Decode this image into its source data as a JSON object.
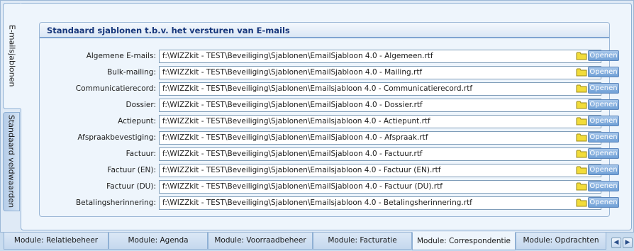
{
  "vertical_tabs": {
    "emails_label": "E-mailsjablonen",
    "defaults_label": "Standaard veldwaarden"
  },
  "group": {
    "title": "Standaard sjablonen t.b.v. het versturen van E-mails"
  },
  "open_label": "Openen",
  "rows": [
    {
      "label": "Algemene E-mails:",
      "value": "f:\\WIZZkit - TEST\\Beveiliging\\Sjablonen\\EmailSjabloon 4.0 - Algemeen.rtf"
    },
    {
      "label": "Bulk-mailing:",
      "value": "f:\\WIZZkit - TEST\\Beveiliging\\Sjablonen\\EmailSjabloon 4.0 - Mailing.rtf"
    },
    {
      "label": "Communicatierecord:",
      "value": "f:\\WIZZkit - TEST\\Beveiliging\\Sjablonen\\Emailsjabloon 4.0 - Communicatierecord.rtf"
    },
    {
      "label": "Dossier:",
      "value": "f:\\WIZZkit - TEST\\Beveiliging\\Sjablonen\\EmailSjabloon 4.0 - Dossier.rtf"
    },
    {
      "label": "Actiepunt:",
      "value": "f:\\WIZZkit - TEST\\Beveiliging\\Sjablonen\\Emailsjabloon 4.0 - Actiepunt.rtf"
    },
    {
      "label": "Afspraakbevestiging:",
      "value": "f:\\WIZZkit - TEST\\Beveiliging\\Sjablonen\\EmailSjabloon 4.0 - Afspraak.rtf"
    },
    {
      "label": "Factuur:",
      "value": "f:\\WIZZkit - TEST\\Beveiliging\\Sjablonen\\EmailSjabloon 4.0 - Factuur.rtf"
    },
    {
      "label": "Factuur (EN):",
      "value": "f:\\WIZZkit - TEST\\Beveiliging\\Sjablonen\\Emailsjabloon 4.0 - Factuur (EN).rtf"
    },
    {
      "label": "Factuur (DU):",
      "value": "f:\\WIZZkit - TEST\\Beveiliging\\Sjablonen\\EmailSjabloon 4.0 - Factuur (DU).rtf"
    },
    {
      "label": "Betalingsherinnering:",
      "value": "f:\\WIZZkit - TEST\\Beveiliging\\Sjablonen\\Emailsjabloon 4.0 - Betalingsherinnering.rtf"
    }
  ],
  "module_tabs": [
    "Module: Relatiebeheer",
    "Module: Agenda",
    "Module: Voorraadbeheer",
    "Module: Facturatie",
    "Module: Correspondentie",
    "Module: Opdrachten"
  ],
  "active_module_tab": "Module: Correspondentie",
  "scroll_left_icon": "chevron-left-icon",
  "scroll_right_icon": "chevron-right-icon",
  "colors": {
    "accent": "#7fa4d1",
    "title": "#16367a",
    "button": "#6f9fd6",
    "folder": "#f2dc3a"
  }
}
